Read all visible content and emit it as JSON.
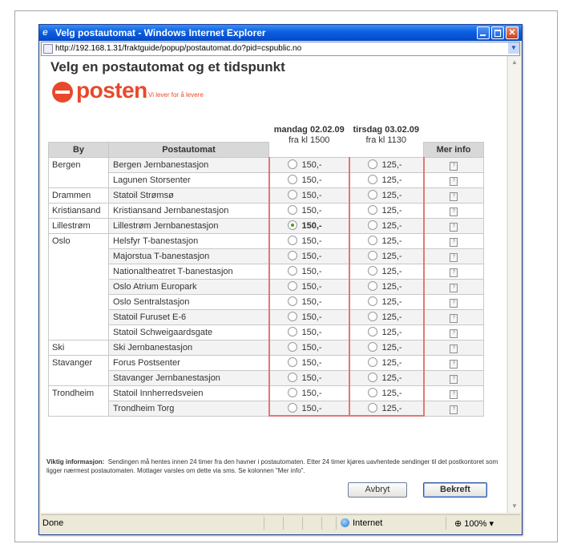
{
  "window": {
    "title": "Velg postautomat - Windows Internet Explorer",
    "url": "http://192.168.1.31/fraktguide/popup/postautomat.do?pid=cspublic.no"
  },
  "page": {
    "heading": "Velg en postautomat og et tidspunkt",
    "logo_word": "posten",
    "logo_tagline": "Vi lever for å levere"
  },
  "table": {
    "columns": {
      "city": "By",
      "location": "Postautomat",
      "info": "Mer info"
    },
    "day1": {
      "date": "mandag 02.02.09",
      "time": "fra kl 1500"
    },
    "day2": {
      "date": "tirsdag 03.02.09",
      "time": "fra kl 1130"
    },
    "price1": "150,-",
    "price2": "125,-",
    "info_icon": "?",
    "cities": [
      "Bergen",
      "Drammen",
      "Kristiansand",
      "Lillestrøm",
      "Oslo",
      "Ski",
      "Stavanger",
      "Trondheim"
    ],
    "rows": [
      "Bergen Jernbanestasjon",
      "Lagunen Storsenter",
      "Statoil Strømsø",
      "Kristiansand Jernbanestasjon",
      "Lillestrøm Jernbanestasjon",
      "Helsfyr T-banestasjon",
      "Majorstua T-banestasjon",
      "Nationaltheatret T-banestasjon",
      "Oslo Atrium Europark",
      "Oslo Sentralstasjon",
      "Statoil Furuset E-6",
      "Statoil Schweigaardsgate",
      "Ski Jernbanestasjon",
      "Forus Postsenter",
      "Stavanger Jernbanestasjon",
      "Statoil Innherredsveien",
      "Trondheim Torg"
    ],
    "selected": {
      "row": "Lillestrøm Jernbanestasjon",
      "day": "mandag 02.02.09"
    }
  },
  "info_note": {
    "label": "Viktig informasjon:",
    "text": "Sendingen må hentes innen 24 timer fra den havner i postautomaten. Etter 24 timer kjøres uavhentede sendinger til det postkontoret som ligger nærmest postautomaten. Mottager varsles om dette via sms. Se kolonnen \"Mer info\"."
  },
  "buttons": {
    "cancel": "Avbryt",
    "confirm": "Bekreft"
  },
  "statusbar": {
    "status": "Done",
    "zone": "Internet",
    "zoom": "100%"
  },
  "colors": {
    "brand": "#e8492b",
    "highlight_border": "#e07878",
    "title_bar": "#0a5fe0"
  }
}
